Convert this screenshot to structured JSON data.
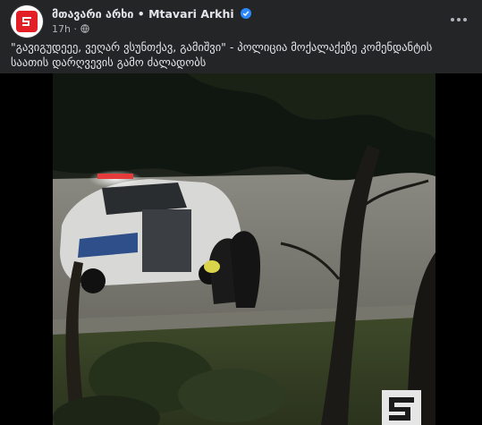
{
  "post": {
    "author": "მთავარი არხი • Mtavari Arkhi",
    "time": "17h",
    "separator": "·",
    "text": "\"გავიგუდეეე, ვეღარ ვსუნთქავ, გამიშვი\" - პოლიცია მოქალაქეზე კომენდანტის საათის დარღვევის გამო ძალადობს"
  },
  "icons": {
    "avatar": "mtavari-logo",
    "verified": "verified-badge-icon",
    "audience": "globe-icon",
    "more": "more-options-icon",
    "watermark": "mtavari-watermark-icon"
  },
  "colors": {
    "background": "#242526",
    "text": "#e4e6eb",
    "meta": "#b0b3b8",
    "verified": "#2d88ff",
    "brand": "#e41e26"
  }
}
